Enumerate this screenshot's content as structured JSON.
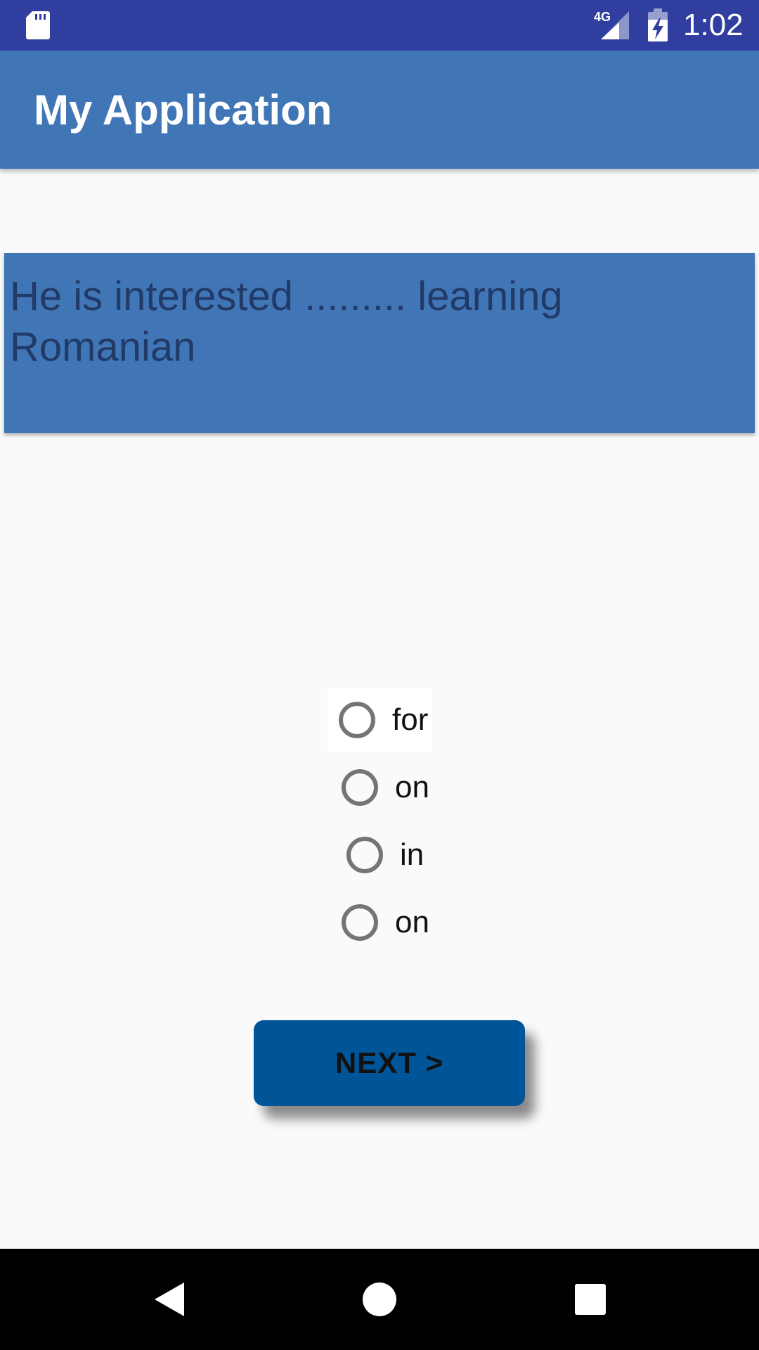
{
  "status_bar": {
    "network": "4G",
    "time": "1:02",
    "icons": [
      "sd-card-icon",
      "signal-icon",
      "battery-charging-icon"
    ]
  },
  "app_bar": {
    "title": "My Application"
  },
  "question": {
    "text": "He is interested ......... learning Romanian"
  },
  "options": [
    {
      "label": "for"
    },
    {
      "label": "on"
    },
    {
      "label": "in"
    },
    {
      "label": "on"
    }
  ],
  "next_button": {
    "label": "NEXT >"
  },
  "nav_bar": {
    "icons": [
      "back-icon",
      "home-icon",
      "recents-icon"
    ]
  },
  "colors": {
    "status_bar": "#303f9f",
    "app_bar": "#4176b6",
    "question_card": "#4176b6",
    "question_text": "#213a68",
    "next_button": "#005598"
  }
}
